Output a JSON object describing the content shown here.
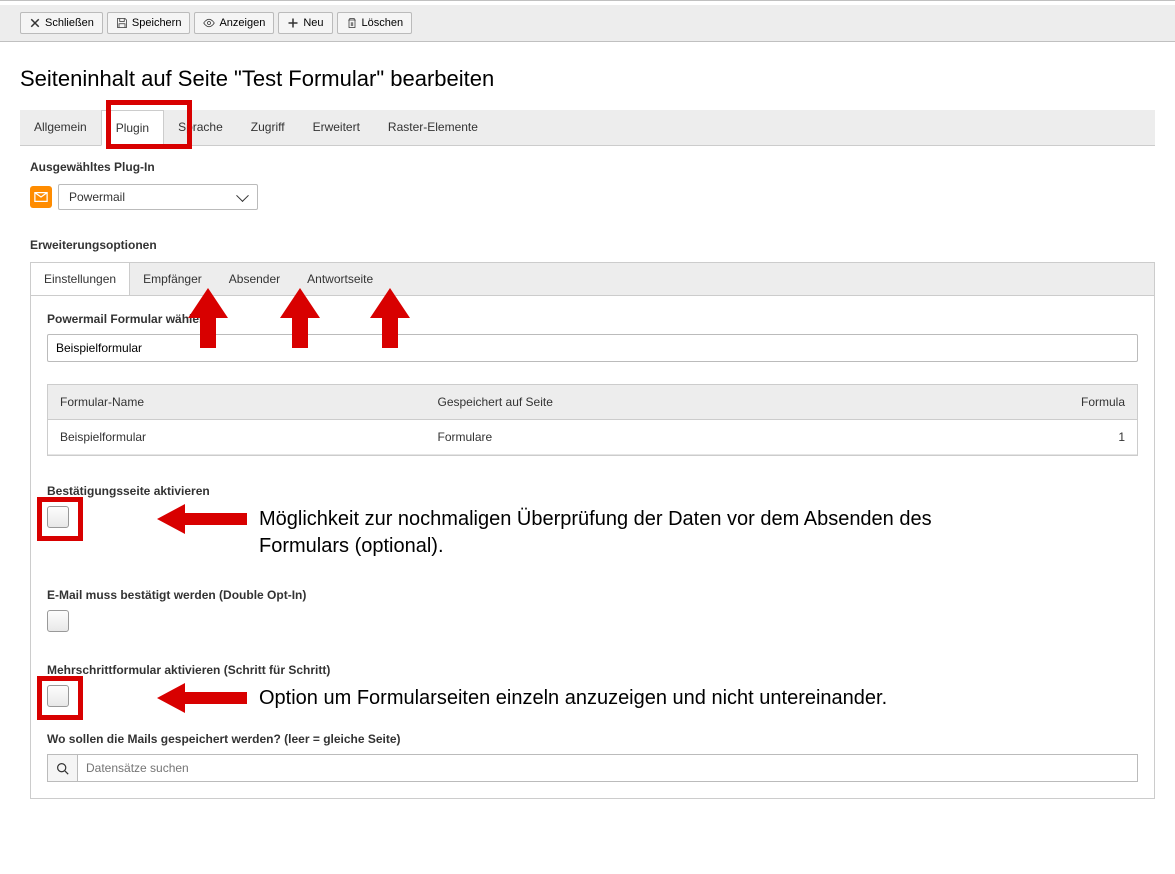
{
  "toolbar": {
    "close": "Schließen",
    "save": "Speichern",
    "view": "Anzeigen",
    "new": "Neu",
    "delete": "Löschen"
  },
  "page_title": "Seiteninhalt auf Seite \"Test Formular\" bearbeiten",
  "main_tabs": [
    "Allgemein",
    "Plugin",
    "Sprache",
    "Zugriff",
    "Erweitert",
    "Raster-Elemente"
  ],
  "main_tab_active": 1,
  "plugin_section": {
    "label": "Ausgewähltes Plug-In",
    "selected": "Powermail"
  },
  "ext_options": {
    "label": "Erweiterungsoptionen",
    "tabs": [
      "Einstellungen",
      "Empfänger",
      "Absender",
      "Antwortseite"
    ],
    "active": 0,
    "form_select_label": "Powermail Formular wählen",
    "form_select_value": "Beispielformular",
    "table": {
      "headers": [
        "Formular-Name",
        "Gespeichert auf Seite",
        "Formula"
      ],
      "rows": [
        {
          "name": "Beispielformular",
          "saved": "Formulare",
          "count": "1"
        }
      ]
    },
    "confirm_page": {
      "label": "Bestätigungsseite aktivieren",
      "annotation": "Möglichkeit zur nochmaligen Überprüfung der Daten vor dem Absenden des Formulars (optional)."
    },
    "double_optin": {
      "label": "E-Mail muss bestätigt werden (Double Opt-In)"
    },
    "multistep": {
      "label": "Mehrschrittformular aktivieren (Schritt für Schritt)",
      "annotation": "Option um Formularseiten einzeln anzuzeigen und nicht untereinander."
    },
    "mail_storage": {
      "label": "Wo sollen die Mails gespeichert werden? (leer = gleiche Seite)",
      "placeholder": "Datensätze suchen"
    }
  }
}
